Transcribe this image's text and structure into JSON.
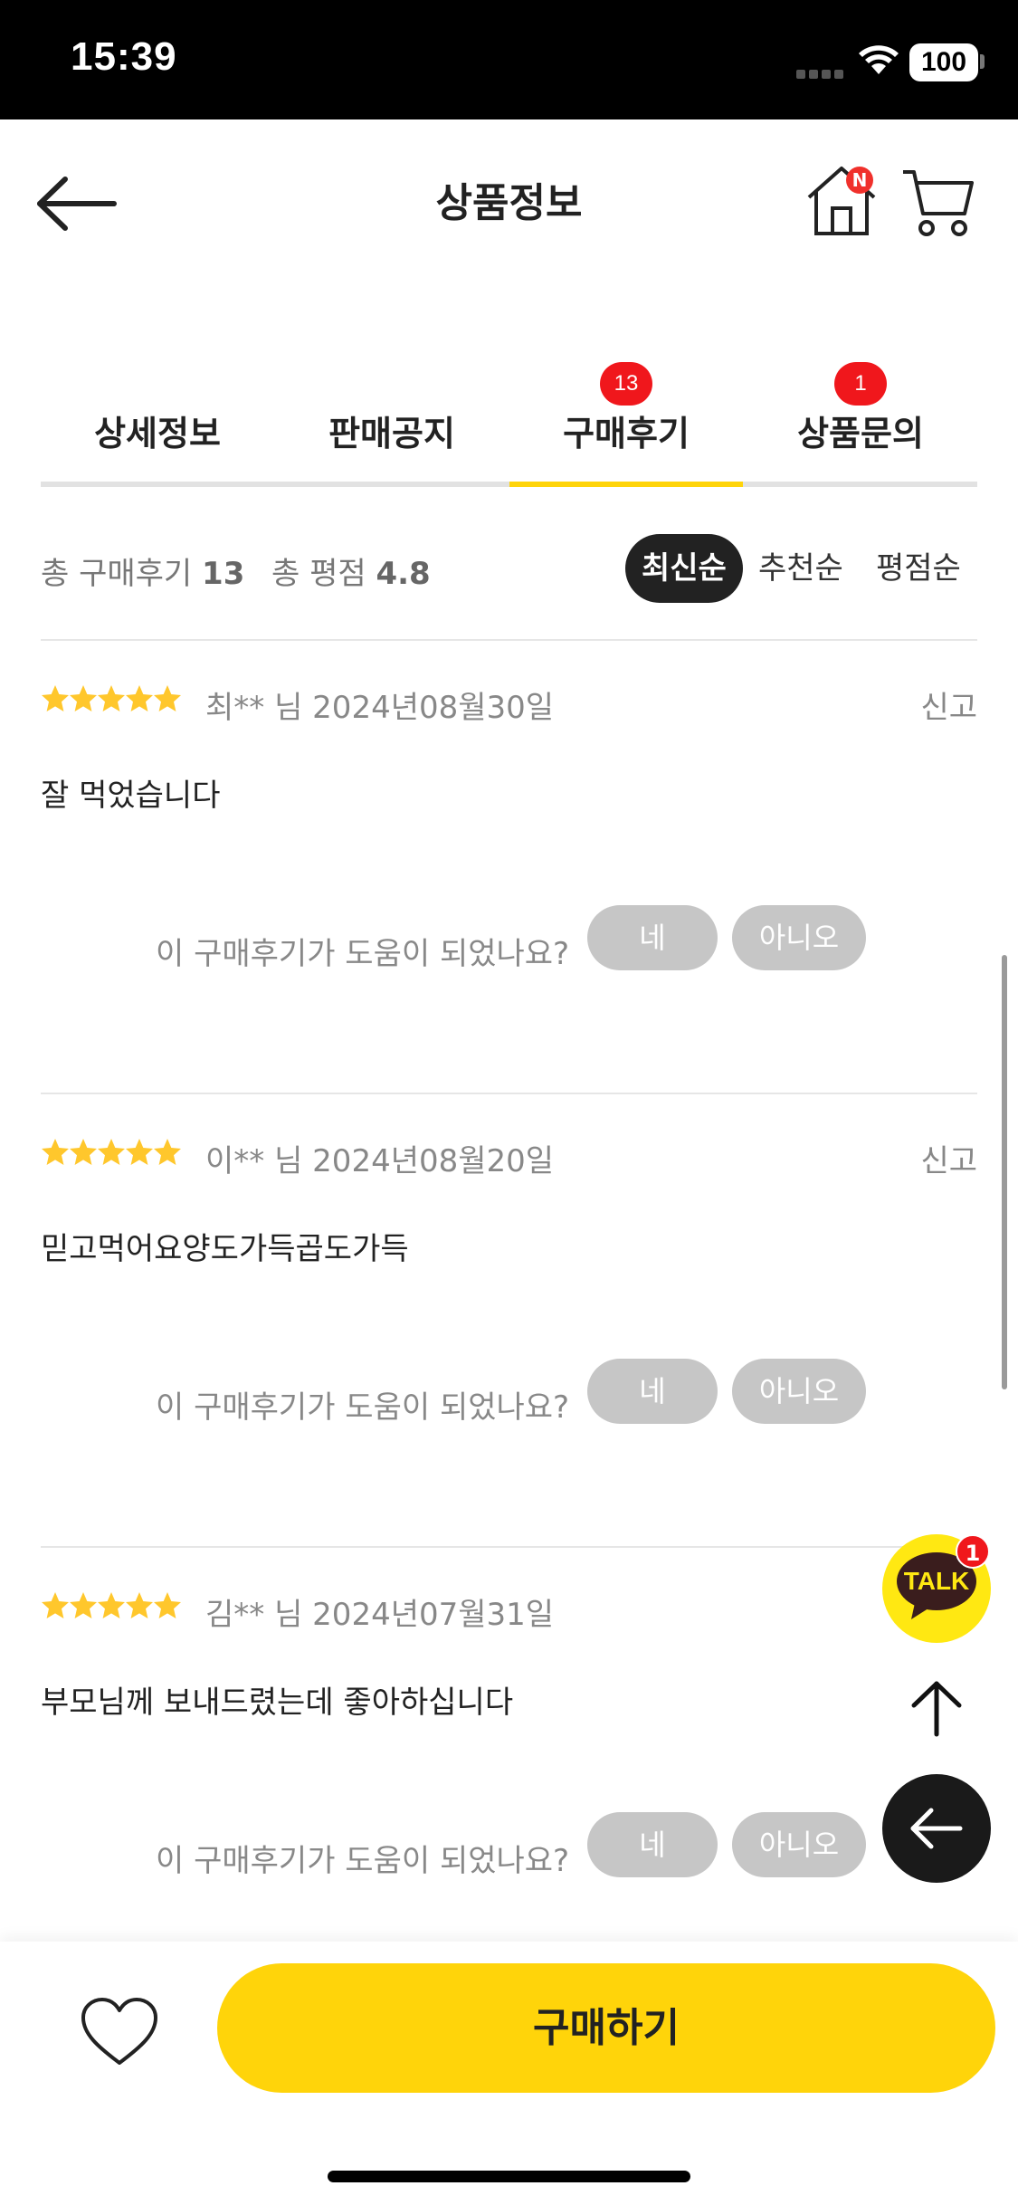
{
  "status_bar": {
    "time": "15:39",
    "battery": "100"
  },
  "header": {
    "title": "상품정보",
    "home_badge": "N"
  },
  "tabs": [
    {
      "label": "상세정보",
      "badge": ""
    },
    {
      "label": "판매공지",
      "badge": ""
    },
    {
      "label": "구매후기",
      "badge": "13",
      "active": true
    },
    {
      "label": "상품문의",
      "badge": "1"
    }
  ],
  "summary": {
    "total_reviews_label": "총 구매후기",
    "total_reviews_value": "13",
    "total_rating_label": "총 평점",
    "total_rating_value": "4.8",
    "sort_options": [
      "최신순",
      "추천순",
      "평점순"
    ],
    "active_sort": "최신순"
  },
  "reviews": [
    {
      "stars": 5,
      "meta": "최** 님 2024년08월30일",
      "report": "신고",
      "content": "잘 먹었습니다",
      "helpful_q": "이 구매후기가 도움이 되었나요?",
      "yes": "네",
      "no": "아니오"
    },
    {
      "stars": 5,
      "meta": "이** 님 2024년08월20일",
      "report": "신고",
      "content": "믿고먹어요양도가득곱도가득",
      "helpful_q": "이 구매후기가 도움이 되었나요?",
      "yes": "네",
      "no": "아니오"
    },
    {
      "stars": 5,
      "meta": "김** 님 2024년07월31일",
      "report": "",
      "content": "부모님께 보내드렸는데 좋아하십니다",
      "helpful_q": "이 구매후기가 도움이 되었나요?",
      "yes": "네",
      "no": "아니오"
    }
  ],
  "floating": {
    "talk_label": "TALK",
    "talk_badge": "1"
  },
  "bottom_bar": {
    "buy_label": "구매하기"
  },
  "colors": {
    "accent_yellow": "#ffd40a",
    "badge_red": "#f0171c",
    "star_yellow": "#ffc72c"
  }
}
